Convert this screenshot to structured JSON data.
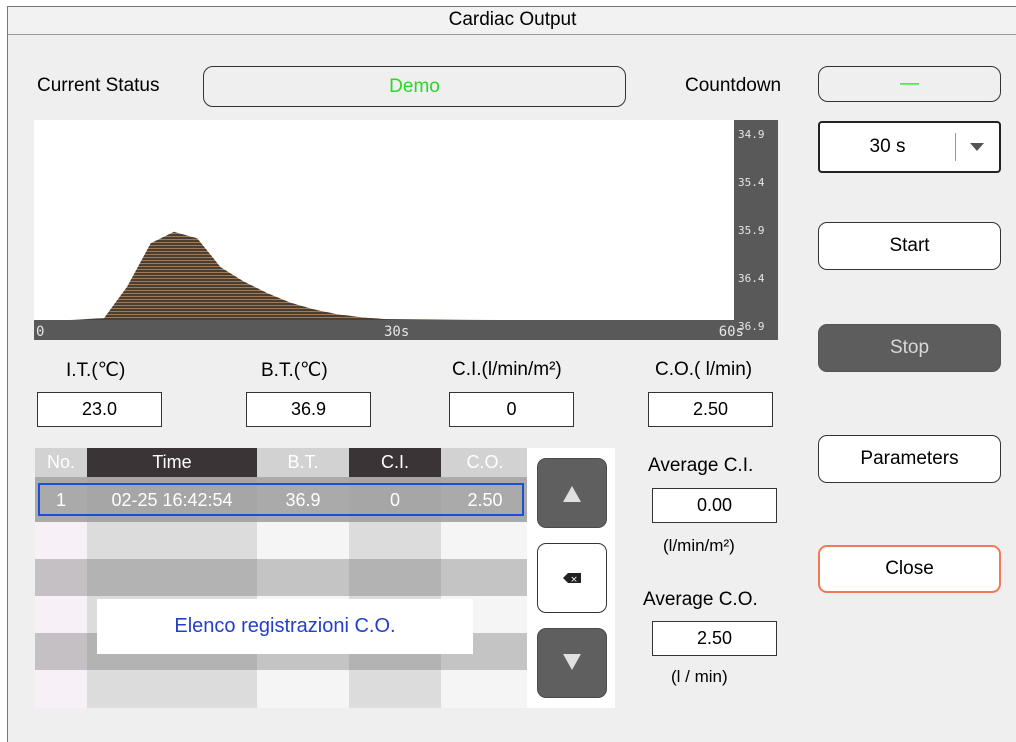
{
  "window": {
    "title": "Cardiac Output"
  },
  "status": {
    "current_status_label": "Current Status",
    "current_status_value": "Demo",
    "countdown_label": "Countdown",
    "countdown_value": "—"
  },
  "chart_data": {
    "type": "area",
    "x_ticks": [
      "0",
      "30s",
      "60s"
    ],
    "y_ticks": [
      "34.9",
      "35.4",
      "35.9",
      "36.4",
      "36.9"
    ],
    "xlim": [
      0,
      60
    ],
    "ylim": [
      36.9,
      34.9
    ],
    "x": [
      0,
      3,
      6,
      8,
      10,
      12,
      14,
      16,
      18,
      20,
      22,
      24,
      26,
      28,
      30,
      40,
      60
    ],
    "y": [
      36.9,
      36.9,
      36.88,
      36.55,
      36.1,
      35.98,
      36.05,
      36.35,
      36.5,
      36.62,
      36.72,
      36.79,
      36.84,
      36.87,
      36.89,
      36.9,
      36.9
    ],
    "colors": {
      "fill": "#a07a55",
      "stroke": "#1a1a1a",
      "axis_bar": "#595959"
    }
  },
  "measurements": {
    "it_label": "I.T.(℃)",
    "it_value": "23.0",
    "bt_label": "B.T.(℃)",
    "bt_value": "36.9",
    "ci_label": "C.I.(l/min/m²)",
    "ci_value": "0",
    "co_label": "C.O.( l/min)",
    "co_value": "2.50"
  },
  "controls": {
    "time_select": "30 s",
    "start": "Start",
    "stop": "Stop",
    "parameters": "Parameters",
    "close": "Close"
  },
  "table": {
    "headers": [
      "No.",
      "Time",
      "B.T.",
      "C.I.",
      "C.O."
    ],
    "rows": [
      {
        "no": "1",
        "time": "02-25 16:42:54",
        "bt": "36.9",
        "ci": "0",
        "co": "2.50"
      }
    ]
  },
  "averages": {
    "avg_ci_label": "Average C.I.",
    "avg_ci_value": "0.00",
    "avg_ci_unit": "(l/min/m²)",
    "avg_co_label": "Average C.O.",
    "avg_co_value": "2.50",
    "avg_co_unit": "(l / min)"
  },
  "overlay": {
    "caption": "Elenco registrazioni C.O."
  }
}
